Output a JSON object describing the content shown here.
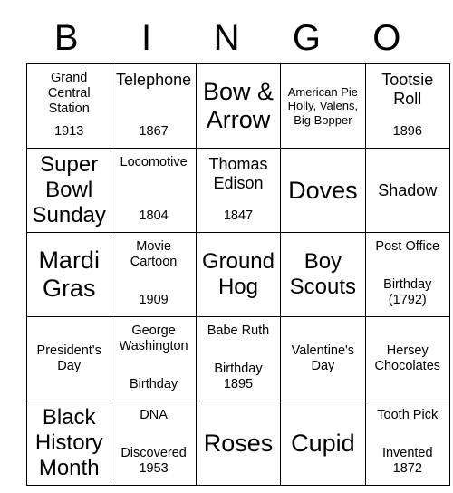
{
  "header": {
    "letters": [
      "B",
      "I",
      "N",
      "G",
      "O"
    ]
  },
  "grid": {
    "rows": [
      [
        {
          "main": "Grand\nCentral\nStation",
          "sub": "1913"
        },
        {
          "main": "Telephone",
          "sub": "1867"
        },
        {
          "main": "Bow &\nArrow",
          "sub": ""
        },
        {
          "main": "American Pie\nHolly, Valens,\nBig Bopper",
          "sub": ""
        },
        {
          "main": "Tootsie\nRoll",
          "sub": "1896"
        }
      ],
      [
        {
          "main": "Super\nBowl\nSunday",
          "sub": ""
        },
        {
          "main": "Locomotive",
          "sub": "1804"
        },
        {
          "main": "Thomas\nEdison",
          "sub": "1847"
        },
        {
          "main": "Doves",
          "sub": ""
        },
        {
          "main": "Shadow",
          "sub": ""
        }
      ],
      [
        {
          "main": "Mardi\nGras",
          "sub": ""
        },
        {
          "main": "Movie\nCartoon",
          "sub": "1909"
        },
        {
          "main": "Ground\nHog",
          "sub": ""
        },
        {
          "main": "Boy\nScouts",
          "sub": ""
        },
        {
          "main": "Post Office",
          "sub": "Birthday\n(1792)"
        }
      ],
      [
        {
          "main": "President's\nDay",
          "sub": ""
        },
        {
          "main": "George\nWashington",
          "sub": "Birthday"
        },
        {
          "main": "Babe Ruth",
          "sub": "Birthday\n1895"
        },
        {
          "main": "Valentine's\nDay",
          "sub": ""
        },
        {
          "main": "Hersey\nChocolates",
          "sub": ""
        }
      ],
      [
        {
          "main": "Black\nHistory\nMonth",
          "sub": ""
        },
        {
          "main": "DNA",
          "sub": "Discovered\n1953"
        },
        {
          "main": "Roses",
          "sub": ""
        },
        {
          "main": "Cupid",
          "sub": ""
        },
        {
          "main": "Tooth Pick",
          "sub": "Invented\n1872"
        }
      ]
    ]
  },
  "style": {
    "border_color": "#000000",
    "background_color": "#ffffff",
    "text_color": "#000000"
  }
}
